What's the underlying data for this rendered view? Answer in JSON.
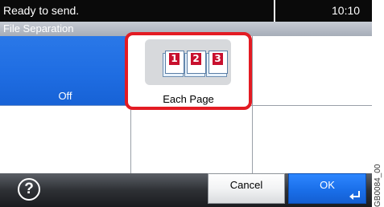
{
  "status_bar": {
    "message": "Ready to send.",
    "time": "10:10"
  },
  "title_bar": {
    "title": "File Separation"
  },
  "options": [
    {
      "label": "Off",
      "selected": true
    },
    {
      "label": "Each Page",
      "selected": false,
      "icon": "three-numbered-pages-icon",
      "icon_numbers": [
        "1",
        "2",
        "3"
      ]
    }
  ],
  "bottom_bar": {
    "help_label": "?",
    "cancel_label": "Cancel",
    "ok_label": "OK"
  },
  "reference_code": "GB0084_00",
  "colors": {
    "selected_blue": "#1f6de2",
    "highlight_red": "#e31b23",
    "page_number_red": "#c8102e"
  }
}
